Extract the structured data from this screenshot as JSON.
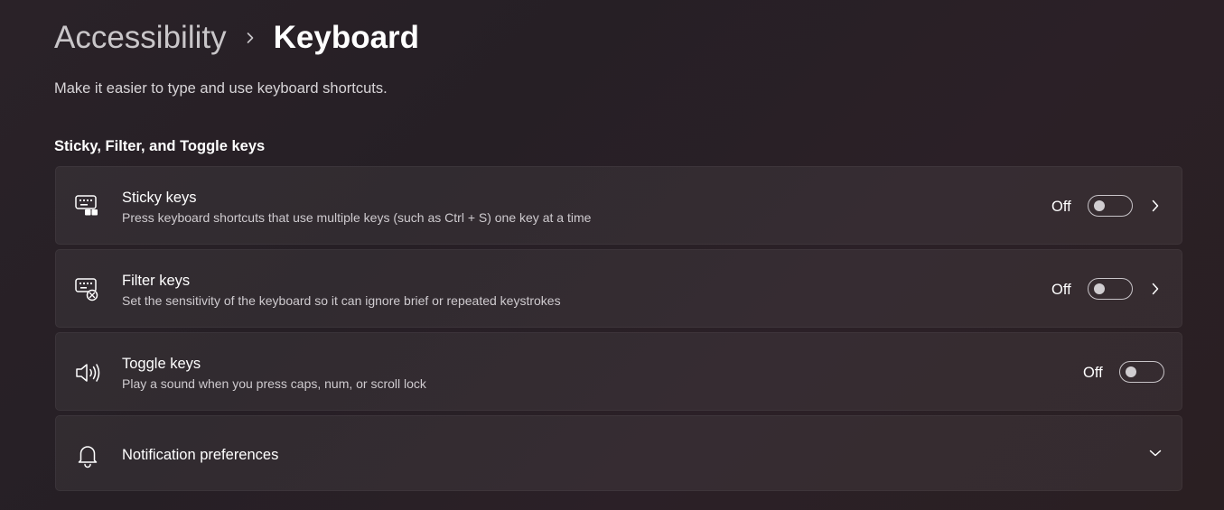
{
  "breadcrumb": {
    "parent": "Accessibility",
    "current": "Keyboard"
  },
  "page_description": "Make it easier to type and use keyboard shortcuts.",
  "section_title": "Sticky, Filter, and Toggle keys",
  "settings": [
    {
      "title": "Sticky keys",
      "description": "Press keyboard shortcuts that use multiple keys (such as Ctrl + S) one key at a time",
      "state": "Off",
      "on": false,
      "icon": "sticky-keys-icon"
    },
    {
      "title": "Filter keys",
      "description": "Set the sensitivity of the keyboard so it can ignore brief or repeated keystrokes",
      "state": "Off",
      "on": false,
      "icon": "filter-keys-icon"
    },
    {
      "title": "Toggle keys",
      "description": "Play a sound when you press caps, num, or scroll lock",
      "state": "Off",
      "on": false,
      "icon": "speaker-icon"
    }
  ],
  "notifications": {
    "title": "Notification preferences",
    "icon": "bell-icon"
  },
  "colors": {
    "card_background": "#322a31",
    "text_primary": "#ffffff",
    "text_secondary": "#cfcbcf"
  }
}
